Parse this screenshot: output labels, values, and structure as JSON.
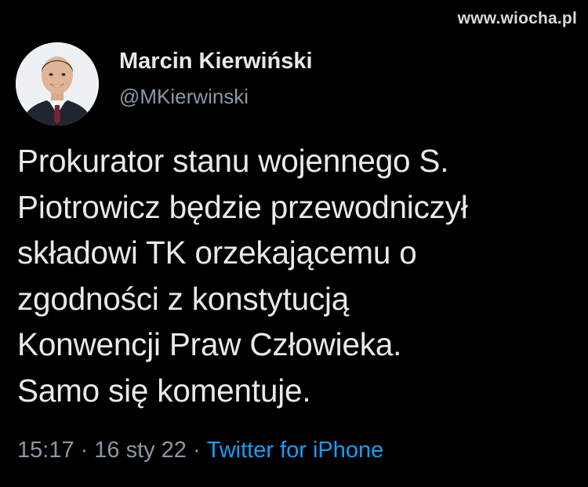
{
  "watermark": "www.wiocha.pl",
  "tweet": {
    "author": {
      "display_name": "Marcin Kierwiński",
      "handle": "@MKierwinski",
      "avatar_icon": "profile-photo"
    },
    "text_lines": [
      "Prokurator stanu wojennego S.",
      "Piotrowicz będzie przewodniczył",
      "składowi TK orzekającemu o",
      "zgodności z konstytucją",
      "Konwencji Praw Człowieka.",
      "Samo się komentuje."
    ],
    "meta": {
      "time": "15:17",
      "separator": "·",
      "date": "16 sty 22",
      "source": "Twitter for iPhone"
    }
  },
  "colors": {
    "background": "#000000",
    "text_primary": "#e7e9ea",
    "text_secondary": "#8b98a5",
    "link": "#1d9bf0"
  }
}
